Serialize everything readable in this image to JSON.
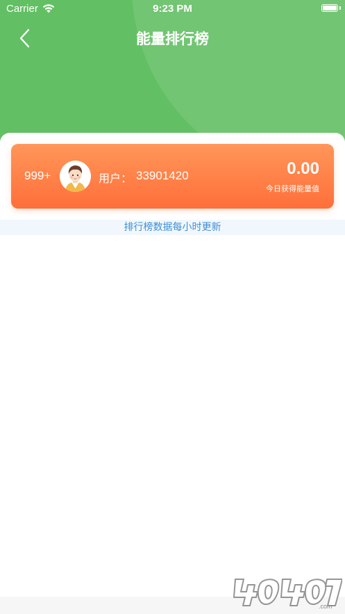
{
  "status_bar": {
    "carrier": "Carrier",
    "time": "9:23 PM"
  },
  "nav": {
    "title": "能量排行榜",
    "back_icon": "chevron-left-icon"
  },
  "my_rank": {
    "rank": "999+",
    "user_label": "用户：",
    "user_id": "33901420",
    "energy_value": "0.00",
    "energy_caption": "今日获得能量值"
  },
  "update_note": "排行榜数据每小时更新",
  "watermark": {
    "text": "4O4O7",
    "suffix": ".com"
  },
  "colors": {
    "header_green": "#63bf63",
    "card_orange_top": "#ff9659",
    "card_orange_bottom": "#ff6f3a",
    "note_blue": "#3d8ed7",
    "note_bg": "#f1f7fc"
  }
}
